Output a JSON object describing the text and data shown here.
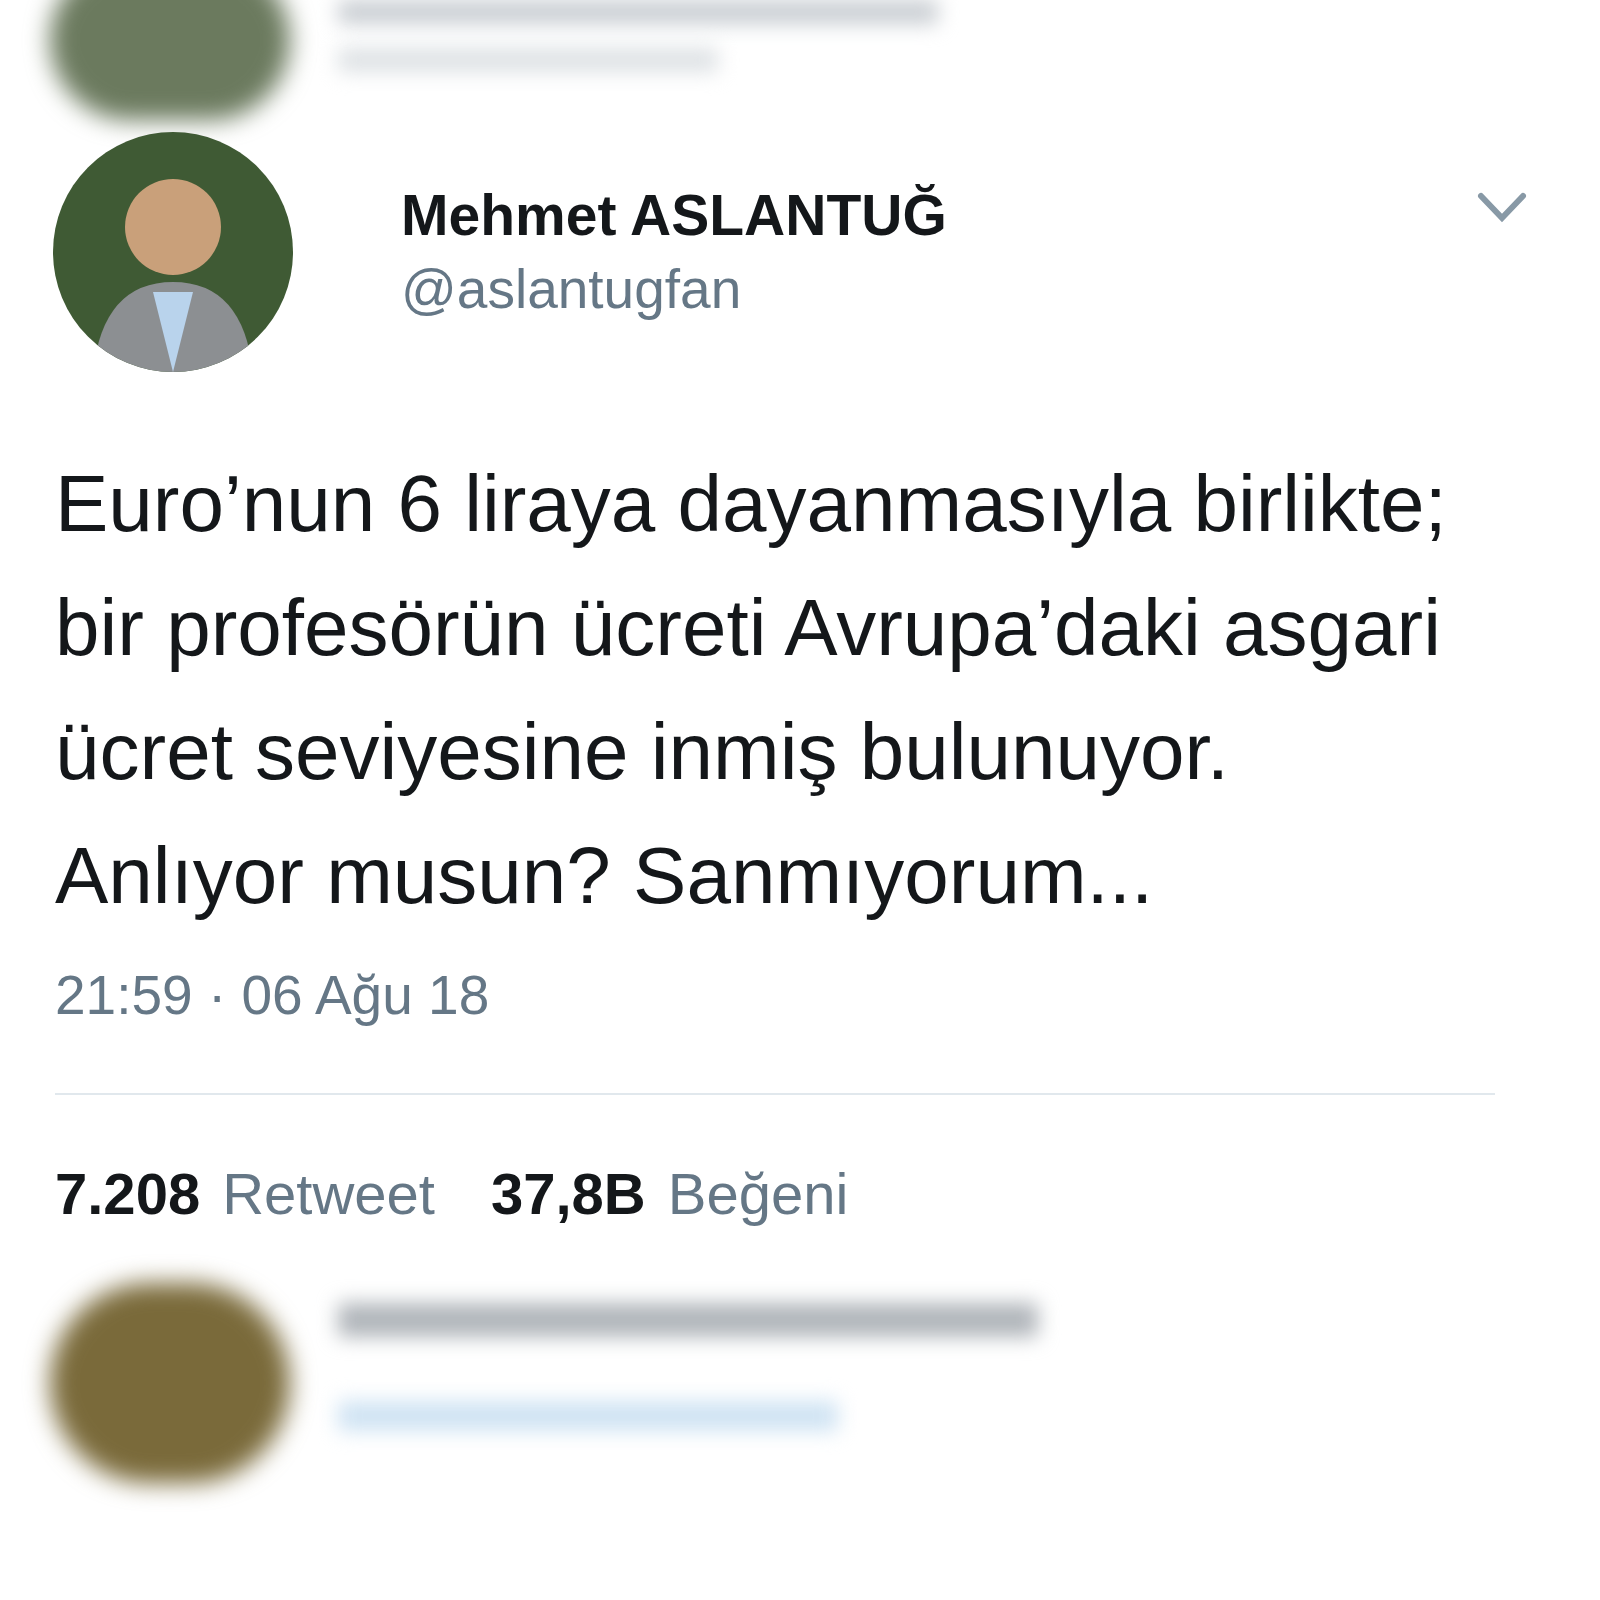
{
  "tweet": {
    "name": "Mehmet ASLANTUĞ",
    "handle": "@aslantugfan",
    "text": "Euro’nun 6 liraya dayanmasıyla birlikte; bir profesörün ücreti Avrupa’daki asgari ücret seviyesine inmiş bulunuyor. Anlıyor musun? Sanmıyorum...",
    "timestamp": "21:59 · 06 Ağu 18",
    "stats": [
      {
        "count": "7.208",
        "label": "Retweet"
      },
      {
        "count": "37,8B",
        "label": "Beğeni"
      }
    ]
  }
}
